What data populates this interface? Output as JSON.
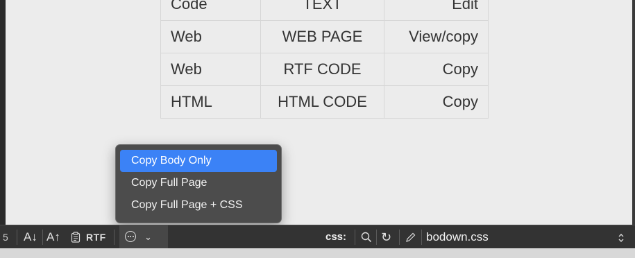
{
  "table": {
    "rows": [
      [
        "Code",
        "TEXT",
        "Edit"
      ],
      [
        "Web",
        "WEB PAGE",
        "View/copy"
      ],
      [
        "Web",
        "RTF CODE",
        "Copy"
      ],
      [
        "HTML",
        "HTML CODE",
        "Copy"
      ]
    ]
  },
  "menu": {
    "items": [
      {
        "label": "Copy Body Only",
        "selected": true
      },
      {
        "label": "Copy Full Page",
        "selected": false
      },
      {
        "label": "Copy Full Page + CSS",
        "selected": false
      }
    ]
  },
  "toolbar": {
    "line_number": "5",
    "sort_asc_label": "A↓",
    "sort_desc_label": "A↑",
    "rtf_label": "RTF",
    "css_label": "css:",
    "stylesheet_name": "bodown.css"
  },
  "colors": {
    "accent": "#3b82f6",
    "toolbar_bg": "#333333",
    "menu_bg": "#464646",
    "content_bg": "#ececec"
  },
  "icons": [
    "clipboard-icon",
    "more-options-icon",
    "chevron-down-icon",
    "search-icon",
    "reload-icon",
    "pencil-icon",
    "updown-chevron-icon"
  ]
}
